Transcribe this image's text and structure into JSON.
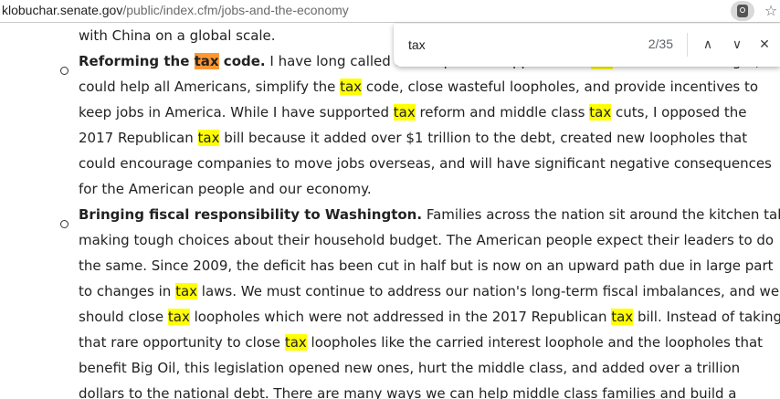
{
  "browser": {
    "url_host": "klobuchar.senate.gov",
    "url_path": "/public/index.cfm/jobs-and-the-economy",
    "lens_icon": "google-lens-icon",
    "star_icon": "bookmark-star-icon",
    "star_glyph": "☆"
  },
  "find_bar": {
    "query": "tax",
    "match_count": "2/35",
    "prev_glyph": "∧",
    "next_glyph": "∨",
    "close_glyph": "✕"
  },
  "colors": {
    "highlight": "#ffff00",
    "active_highlight": "#ff9632"
  },
  "article": {
    "lines": [
      [
        {
          "t": "with China on a global scale."
        }
      ],
      [
        {
          "t": "Reforming the ",
          "b": true
        },
        {
          "t": "tax",
          "b": true,
          "h": "active"
        },
        {
          "t": " code.",
          "b": true
        },
        {
          "t": " I have long called for a bipartisan approach to "
        },
        {
          "t": "tax",
          "h": "match"
        },
        {
          "t": " reform. If done right, we"
        }
      ],
      [
        {
          "t": "could help all Americans, simplify the "
        },
        {
          "t": "tax",
          "h": "match"
        },
        {
          "t": " code, close wasteful loopholes, and provide incentives to"
        }
      ],
      [
        {
          "t": "keep jobs in America. While I have supported "
        },
        {
          "t": "tax",
          "h": "match"
        },
        {
          "t": " reform and middle class "
        },
        {
          "t": "tax",
          "h": "match"
        },
        {
          "t": " cuts, I opposed the"
        }
      ],
      [
        {
          "t": "2017 Republican "
        },
        {
          "t": "tax",
          "h": "match"
        },
        {
          "t": " bill because it added over $1 trillion to the debt, created new loopholes that"
        }
      ],
      [
        {
          "t": "could encourage companies to move jobs overseas, and will have significant negative consequences"
        }
      ],
      [
        {
          "t": "for the American people and our economy."
        }
      ],
      [
        {
          "t": "Bringing fiscal responsibility to Washington.",
          "b": true
        },
        {
          "t": " Families across the nation sit around the kitchen table"
        }
      ],
      [
        {
          "t": "making tough choices about their household budget. The American people expect their leaders to do"
        }
      ],
      [
        {
          "t": "the same. Since 2009, the deficit has been cut in half but is now on an upward path due in large part"
        }
      ],
      [
        {
          "t": "to changes in "
        },
        {
          "t": "tax",
          "h": "match"
        },
        {
          "t": " laws. We must continue to address our nation's long-term fiscal imbalances, and we"
        }
      ],
      [
        {
          "t": "should close "
        },
        {
          "t": "tax",
          "h": "match"
        },
        {
          "t": " loopholes which were not addressed in the 2017 Republican "
        },
        {
          "t": "tax",
          "h": "match"
        },
        {
          "t": " bill. Instead of taking"
        }
      ],
      [
        {
          "t": "that rare opportunity to close "
        },
        {
          "t": "tax",
          "h": "match"
        },
        {
          "t": " loopholes like the carried interest loophole and the loopholes that"
        }
      ],
      [
        {
          "t": "benefit Big Oil, this legislation opened new ones, hurt the middle class, and added over a trillion"
        }
      ],
      [
        {
          "t": "dollars to the national debt. There are many ways we can help middle class families and build a"
        }
      ]
    ]
  }
}
